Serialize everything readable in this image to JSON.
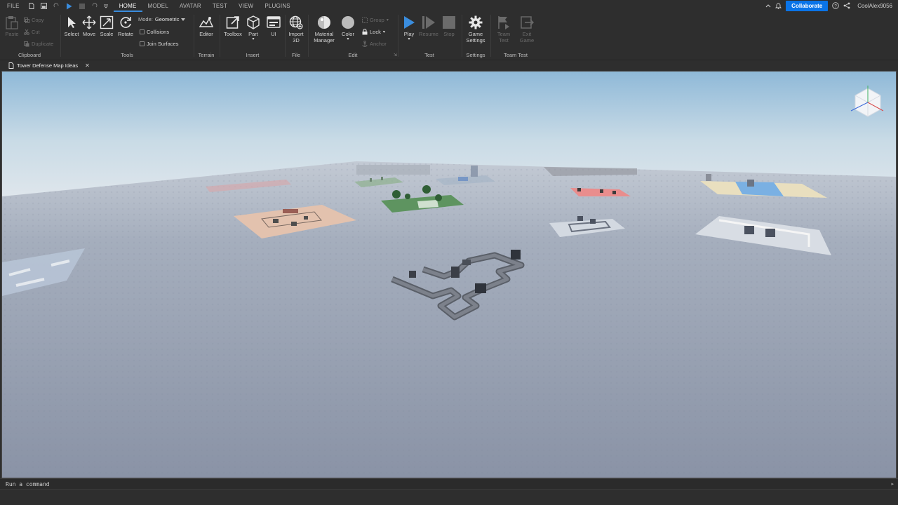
{
  "menubar": {
    "file_label": "FILE",
    "tabs": [
      {
        "label": "HOME",
        "active": true
      },
      {
        "label": "MODEL"
      },
      {
        "label": "AVATAR"
      },
      {
        "label": "TEST"
      },
      {
        "label": "VIEW"
      },
      {
        "label": "PLUGINS"
      }
    ],
    "collaborate_label": "Collaborate",
    "username": "CoolAlex9056"
  },
  "ribbon": {
    "clipboard": {
      "group_label": "Clipboard",
      "paste_label": "Paste",
      "copy_label": "Copy",
      "cut_label": "Cut",
      "duplicate_label": "Duplicate"
    },
    "tools": {
      "group_label": "Tools",
      "select_label": "Select",
      "move_label": "Move",
      "scale_label": "Scale",
      "rotate_label": "Rotate",
      "mode_label": "Mode:",
      "mode_value": "Geometric",
      "collisions_label": "Collisions",
      "join_surfaces_label": "Join Surfaces"
    },
    "terrain": {
      "group_label": "Terrain",
      "editor_label": "Editor"
    },
    "insert": {
      "group_label": "Insert",
      "toolbox_label": "Toolbox",
      "part_label": "Part",
      "ui_label": "UI"
    },
    "file": {
      "group_label": "File",
      "import_label_1": "Import",
      "import_label_2": "3D"
    },
    "edit": {
      "group_label": "Edit",
      "material_label_1": "Material",
      "material_label_2": "Manager",
      "color_label": "Color",
      "group_btn_label": "Group",
      "lock_label": "Lock",
      "anchor_label": "Anchor"
    },
    "test": {
      "group_label": "Test",
      "play_label": "Play",
      "resume_label": "Resume",
      "stop_label": "Stop"
    },
    "settings": {
      "group_label": "Settings",
      "game_settings_1": "Game",
      "game_settings_2": "Settings"
    },
    "team_test": {
      "group_label": "Team Test",
      "team_test_1": "Team",
      "team_test_2": "Test",
      "exit_game_1": "Exit",
      "exit_game_2": "Game"
    }
  },
  "document_tab": {
    "title": "Tower Defense Map Ideas"
  },
  "command_bar": {
    "placeholder": "Run a command"
  },
  "colors": {
    "accent": "#0a74e8",
    "play_blue": "#3a8dde",
    "background": "#2e2e2e"
  }
}
